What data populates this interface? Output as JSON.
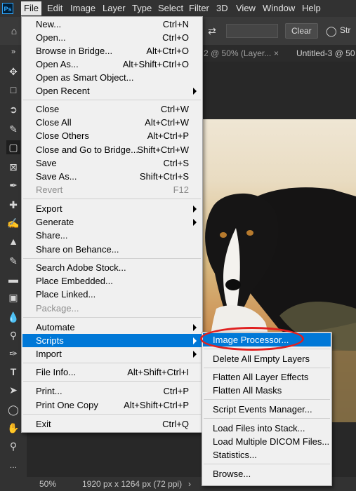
{
  "app": {
    "logo_text": "Ps"
  },
  "menubar": [
    "File",
    "Edit",
    "Image",
    "Layer",
    "Type",
    "Select",
    "Filter",
    "3D",
    "View",
    "Window",
    "Help"
  ],
  "options_bar": {
    "clear_label": "Clear",
    "straighten_label": "Str"
  },
  "tabs": [
    "2 @ 50% (Layer...",
    "Untitled-3 @ 50"
  ],
  "file_menu": [
    {
      "label": "New...",
      "shortcut": "Ctrl+N"
    },
    {
      "label": "Open...",
      "shortcut": "Ctrl+O"
    },
    {
      "label": "Browse in Bridge...",
      "shortcut": "Alt+Ctrl+O"
    },
    {
      "label": "Open As...",
      "shortcut": "Alt+Shift+Ctrl+O"
    },
    {
      "label": "Open as Smart Object...",
      "shortcut": ""
    },
    {
      "label": "Open Recent",
      "shortcut": "",
      "submenu": true
    },
    {
      "label": "Close",
      "shortcut": "Ctrl+W"
    },
    {
      "label": "Close All",
      "shortcut": "Alt+Ctrl+W"
    },
    {
      "label": "Close Others",
      "shortcut": "Alt+Ctrl+P"
    },
    {
      "label": "Close and Go to Bridge...",
      "shortcut": "Shift+Ctrl+W"
    },
    {
      "label": "Save",
      "shortcut": "Ctrl+S"
    },
    {
      "label": "Save As...",
      "shortcut": "Shift+Ctrl+S"
    },
    {
      "label": "Revert",
      "shortcut": "F12",
      "disabled": true
    },
    {
      "label": "Export",
      "shortcut": "",
      "submenu": true
    },
    {
      "label": "Generate",
      "shortcut": "",
      "submenu": true
    },
    {
      "label": "Share...",
      "shortcut": ""
    },
    {
      "label": "Share on Behance...",
      "shortcut": ""
    },
    {
      "label": "Search Adobe Stock...",
      "shortcut": ""
    },
    {
      "label": "Place Embedded...",
      "shortcut": ""
    },
    {
      "label": "Place Linked...",
      "shortcut": ""
    },
    {
      "label": "Package...",
      "shortcut": "",
      "disabled": true
    },
    {
      "label": "Automate",
      "shortcut": "",
      "submenu": true
    },
    {
      "label": "Scripts",
      "shortcut": "",
      "submenu": true,
      "highlight": true
    },
    {
      "label": "Import",
      "shortcut": "",
      "submenu": true
    },
    {
      "label": "File Info...",
      "shortcut": "Alt+Shift+Ctrl+I"
    },
    {
      "label": "Print...",
      "shortcut": "Ctrl+P"
    },
    {
      "label": "Print One Copy",
      "shortcut": "Alt+Shift+Ctrl+P"
    },
    {
      "label": "Exit",
      "shortcut": "Ctrl+Q"
    }
  ],
  "scripts_menu": [
    {
      "label": "Image Processor...",
      "highlight": true
    },
    {
      "label": "Delete All Empty Layers"
    },
    {
      "label": "Flatten All Layer Effects"
    },
    {
      "label": "Flatten All Masks"
    },
    {
      "label": "Script Events Manager..."
    },
    {
      "label": "Load Files into Stack..."
    },
    {
      "label": "Load Multiple DICOM Files..."
    },
    {
      "label": "Statistics..."
    },
    {
      "label": "Browse..."
    }
  ],
  "status": {
    "zoom": "50%",
    "doc_info": "1920 px x 1264 px (72 ppi)"
  },
  "colors": {
    "highlight": "#0078d7",
    "annotation": "#e02020",
    "menu_bg": "#f0f0f0"
  }
}
